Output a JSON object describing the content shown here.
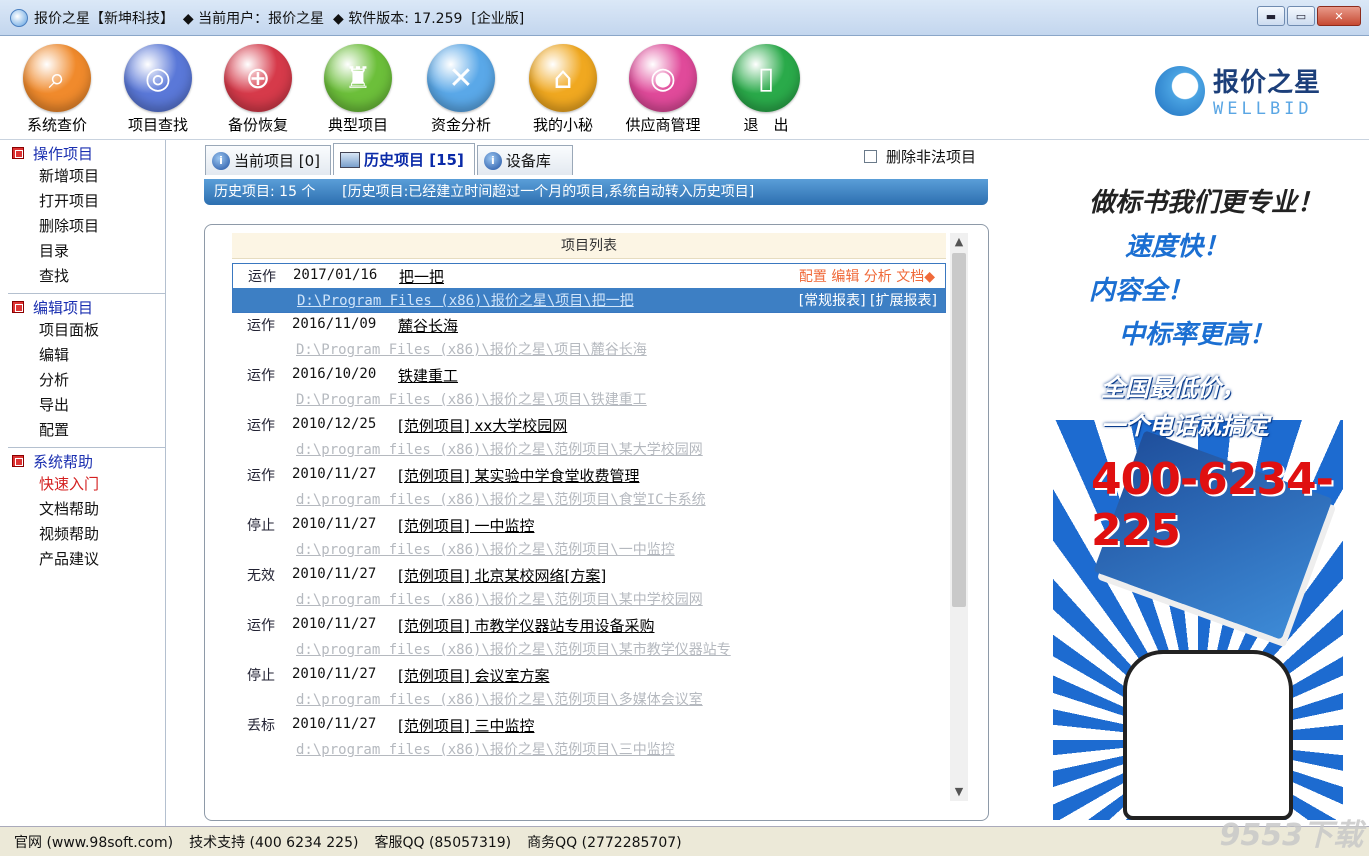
{
  "window": {
    "title": "报价之星【新坤科技】  ◆ 当前用户：报价之星  ◆ 软件版本: 17.259  [企业版]",
    "minimize_glyph": "▬",
    "maximize_glyph": "▭",
    "close_glyph": "✕"
  },
  "toolbar": {
    "items": [
      {
        "label": "系统查价",
        "icon": "search-price-icon",
        "color": "#f08a2c",
        "glyph": "⌕"
      },
      {
        "label": "项目查找",
        "icon": "project-find-icon",
        "color": "#5a78d8",
        "glyph": "◎"
      },
      {
        "label": "备份恢复",
        "icon": "backup-icon",
        "color": "#d63a4a",
        "glyph": "⊕"
      },
      {
        "label": "典型项目",
        "icon": "joystick-icon",
        "color": "#6cbf3a",
        "glyph": "♜"
      },
      {
        "label": "资金分析",
        "icon": "scroll-icon",
        "color": "#5aa8e8",
        "glyph": "✕"
      },
      {
        "label": "我的小秘",
        "icon": "home-icon",
        "color": "#f0a820",
        "glyph": "⌂"
      },
      {
        "label": "供应商管理",
        "icon": "supplier-icon",
        "color": "#e04a9a",
        "glyph": "◉"
      },
      {
        "label": "退　出",
        "icon": "exit-icon",
        "color": "#2aaa4a",
        "glyph": "▯"
      }
    ],
    "logo_cn": "报价之星",
    "logo_en": "WELLBID"
  },
  "sidebar": {
    "sections": [
      {
        "title": "操作项目",
        "items": [
          "新增项目",
          "打开项目",
          "删除项目",
          "目录",
          "查找"
        ]
      },
      {
        "title": "编辑项目",
        "items": [
          "项目面板",
          "编辑",
          "分析",
          "导出",
          "配置"
        ]
      },
      {
        "title": "系统帮助",
        "items": [
          "快速入门",
          "文档帮助",
          "视频帮助",
          "产品建议"
        ],
        "active_index": 0
      }
    ]
  },
  "tabs": [
    {
      "label": "当前项目 [0]",
      "selected": false
    },
    {
      "label": "历史项目 [15]",
      "selected": true
    },
    {
      "label": "设备库",
      "selected": false
    }
  ],
  "delete_illegal_label": "删除非法项目",
  "info_bar": "历史项目: 15 个      [历史项目:已经建立时间超过一个月的项目,系统自动转入历史项目]",
  "list": {
    "header": "项目列表",
    "selected_actions": "配置 编辑 分析 文档◆",
    "selected_reports": "[常规报表] [扩展报表]",
    "rows": [
      {
        "status": "运作",
        "date": "2017/01/16",
        "name": "把一把",
        "path": "D:\\Program Files (x86)\\报价之星\\项目\\把一把"
      },
      {
        "status": "运作",
        "date": "2016/11/09",
        "name": "麓谷长海",
        "path": "D:\\Program Files (x86)\\报价之星\\项目\\麓谷长海"
      },
      {
        "status": "运作",
        "date": "2016/10/20",
        "name": "铁建重工",
        "path": "D:\\Program Files (x86)\\报价之星\\项目\\铁建重工"
      },
      {
        "status": "运作",
        "date": "2010/12/25",
        "name": "[范例项目] xx大学校园网",
        "path": "d:\\program files (x86)\\报价之星\\范例项目\\某大学校园网"
      },
      {
        "status": "运作",
        "date": "2010/11/27",
        "name": "[范例项目] 某实验中学食堂收费管理",
        "path": "d:\\program files (x86)\\报价之星\\范例项目\\食堂IC卡系统"
      },
      {
        "status": "停止",
        "date": "2010/11/27",
        "name": "[范例项目] 一中监控",
        "path": "d:\\program files (x86)\\报价之星\\范例项目\\一中监控"
      },
      {
        "status": "无效",
        "date": "2010/11/27",
        "name": "[范例项目] 北京某校网络[方案]",
        "path": "d:\\program files (x86)\\报价之星\\范例项目\\某中学校园网"
      },
      {
        "status": "运作",
        "date": "2010/11/27",
        "name": "[范例项目] 市教学仪器站专用设备采购",
        "path": "d:\\program files (x86)\\报价之星\\范例项目\\某市教学仪器站专"
      },
      {
        "status": "停止",
        "date": "2010/11/27",
        "name": "[范例项目] 会议室方案",
        "path": "d:\\program files (x86)\\报价之星\\范例项目\\多媒体会议室"
      },
      {
        "status": "丢标",
        "date": "2010/11/27",
        "name": "[范例项目] 三中监控",
        "path": "d:\\program files (x86)\\报价之星\\范例项目\\三中监控"
      }
    ],
    "scroll_up": "▲",
    "scroll_down": "▼"
  },
  "ad": {
    "line1": "做标书我们更专业！",
    "line2": "速度快！",
    "line3": "内容全！",
    "line4": "中标率更高！",
    "line5": "全国最低价，",
    "line6": "一个电话就搞定",
    "phone": "400-6234-225"
  },
  "statusbar": {
    "site": "官网 (www.98soft.com)",
    "tech": "技术支持 (400 6234 225)",
    "qq": "客服QQ (85057319)",
    "biz": "商务QQ (2772285707)"
  },
  "watermark": "9553下载"
}
